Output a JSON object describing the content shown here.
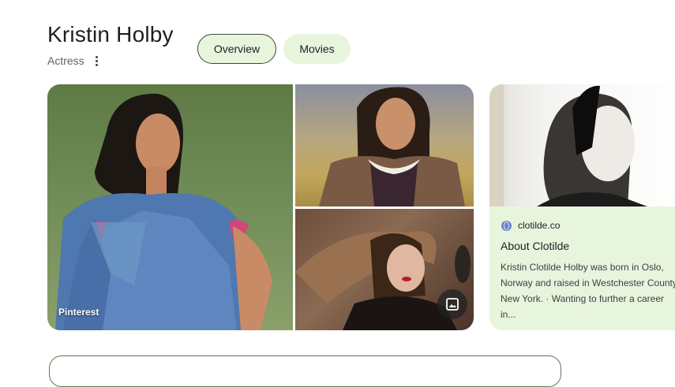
{
  "entity": {
    "name": "Kristin Holby",
    "type": "Actress"
  },
  "tabs": [
    {
      "label": "Overview"
    },
    {
      "label": "Movies"
    }
  ],
  "gallery": {
    "source_label": "Pinterest"
  },
  "source_card": {
    "domain": "clotilde.co",
    "title": "About Clotilde",
    "description": "Kristin Clotilde Holby was born in Oslo,\nNorway and raised in Westchester County\nNew York. · Wanting to further a career in..."
  },
  "colors": {
    "chip_bg": "#e8f5dd",
    "card_bg": "#e8f5dd",
    "chip_border": "#3c4a2f"
  },
  "icons": [
    "more-vert-icon",
    "image-icon",
    "globe-icon"
  ]
}
